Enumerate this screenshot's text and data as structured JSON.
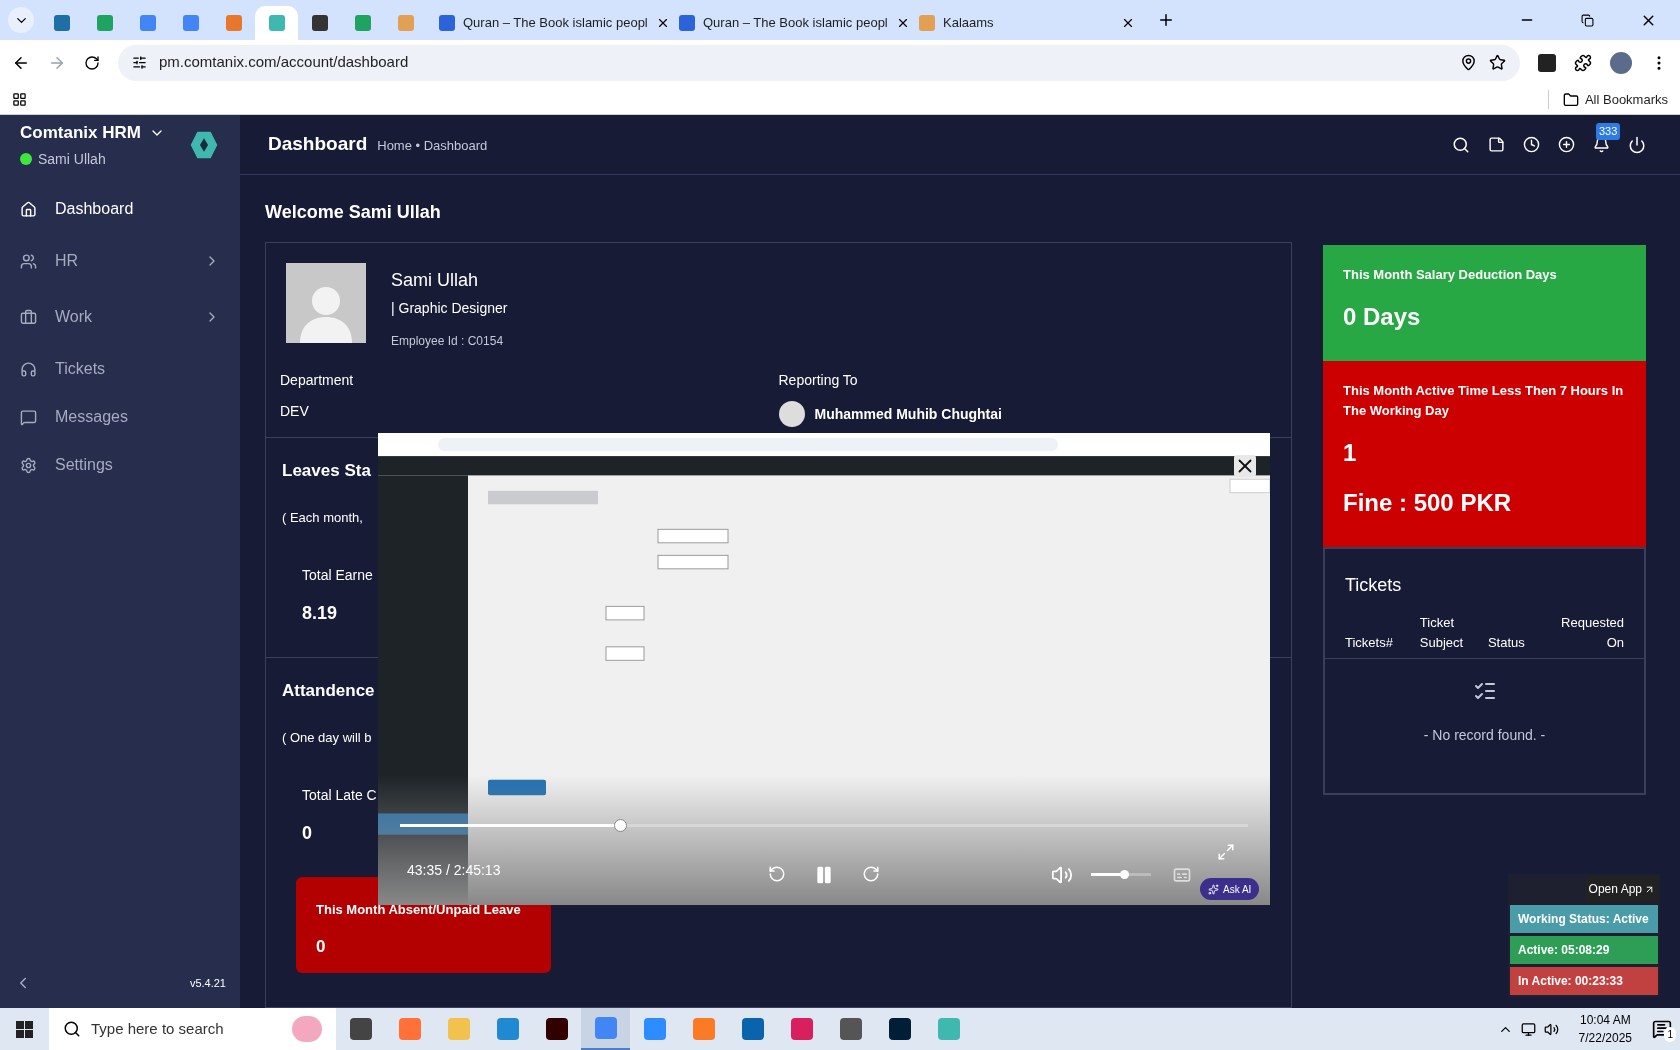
{
  "browser": {
    "tabs": [
      {
        "kind": "icon",
        "color": "#1d6fa5",
        "selected": false
      },
      {
        "kind": "icon",
        "color": "#1ea362",
        "selected": false
      },
      {
        "kind": "icon",
        "color": "#4285f4",
        "selected": false
      },
      {
        "kind": "icon",
        "color": "#4285f4",
        "selected": false
      },
      {
        "kind": "icon",
        "color": "#e8762d",
        "selected": false
      },
      {
        "kind": "icon",
        "color": "#3fb8af",
        "selected": true
      },
      {
        "kind": "icon",
        "color": "#333333",
        "selected": false
      },
      {
        "kind": "icon",
        "color": "#1ea362",
        "selected": false
      },
      {
        "kind": "icon",
        "color": "#e2a055",
        "selected": false
      },
      {
        "kind": "page",
        "color": "#2b63d9",
        "title": "Quran – The Book islamic peopl",
        "selected": false
      },
      {
        "kind": "page",
        "color": "#2b63d9",
        "title": "Quran – The Book islamic peopl",
        "selected": false
      },
      {
        "kind": "page",
        "color": "#e2a055",
        "title": "Kalaams",
        "selected": false
      }
    ],
    "address": "pm.comtanix.com/account/dashboard",
    "bookmarks": "All Bookmarks"
  },
  "sidebar": {
    "app_name": "Comtanix HRM",
    "user_name": "Sami Ullah",
    "online": true,
    "items": [
      {
        "label": "Dashboard",
        "submenu": false,
        "selected": true
      },
      {
        "label": "HR",
        "submenu": true,
        "selected": false
      },
      {
        "label": "Work",
        "submenu": true,
        "selected": false
      },
      {
        "label": "Tickets",
        "submenu": false,
        "selected": false
      },
      {
        "label": "Messages",
        "submenu": false,
        "selected": false
      },
      {
        "label": "Settings",
        "submenu": false,
        "selected": false
      }
    ],
    "version": "v5.4.21"
  },
  "header": {
    "title": "Dashboard",
    "breadcrumb": "Home • Dashboard",
    "notification_count": "333"
  },
  "welcome": "Welcome Sami Ullah",
  "profile": {
    "name": "Sami Ullah",
    "role": "| Graphic Designer",
    "employee_id": "Employee Id : C0154",
    "fields": [
      {
        "label": "Department",
        "value": "DEV",
        "avatar": false
      },
      {
        "label": "Reporting To",
        "value": "Muhammed Muhib Chughtai",
        "avatar": true
      }
    ]
  },
  "sections": [
    {
      "title": "Leaves Sta",
      "note": "( Each month,",
      "stat_label": "Total Earne",
      "stat_value": "8.19"
    },
    {
      "title": "Attandence",
      "note": "( One day will b",
      "stat_label": "Total Late C",
      "stat_value": "0"
    }
  ],
  "absent_card": {
    "title": "This Month Absent/Unpaid Leave",
    "value": "0"
  },
  "summary_cards": [
    {
      "title": "This Month Salary Deduction Days",
      "lines": [
        "0 Days"
      ],
      "color": "#28a745"
    },
    {
      "title": "This Month Active Time Less Then 7 Hours In The Working Day",
      "lines": [
        "1",
        "Fine : 500 PKR"
      ],
      "color": "#cc0000"
    }
  ],
  "tickets": {
    "title": "Tickets",
    "columns": [
      "Tickets#",
      "Ticket Subject",
      "Status",
      "Requested On"
    ],
    "empty": "- No record found. -"
  },
  "video_player": {
    "kind": "picture",
    "time": "43:35 / 2:45:13",
    "progress": {
      "level": 0.26
    },
    "volume": {
      "level": 0.55
    },
    "ask_ai": "Ask AI"
  },
  "status_widget": {
    "open_app": "Open App",
    "rows": [
      {
        "label": "Working Status: Active",
        "color": "#4a9ca8"
      },
      {
        "label": "Active: 05:08:29",
        "color": "#2e9e57"
      },
      {
        "label": "In Active: 00:23:33",
        "color": "#c0413f"
      }
    ]
  },
  "taskbar": {
    "search_placeholder": "Type here to search",
    "apps": [
      {
        "color": "#444444",
        "selected": false
      },
      {
        "color": "#ff7139",
        "selected": false
      },
      {
        "color": "#f2c14e",
        "selected": false
      },
      {
        "color": "#1f8ad2",
        "selected": false
      },
      {
        "color": "#330000",
        "selected": false
      },
      {
        "color": "#4285f4",
        "selected": true
      },
      {
        "color": "#2d8cff",
        "selected": false
      },
      {
        "color": "#fb7a24",
        "selected": false
      },
      {
        "color": "#0a64ad",
        "selected": false
      },
      {
        "color": "#da1f5e",
        "selected": false
      },
      {
        "color": "#555555",
        "selected": false
      },
      {
        "color": "#001e36",
        "selected": false
      },
      {
        "color": "#3fb8af",
        "selected": false
      }
    ],
    "time": "10:04 AM",
    "date": "7/22/2025",
    "notifications": "1"
  }
}
